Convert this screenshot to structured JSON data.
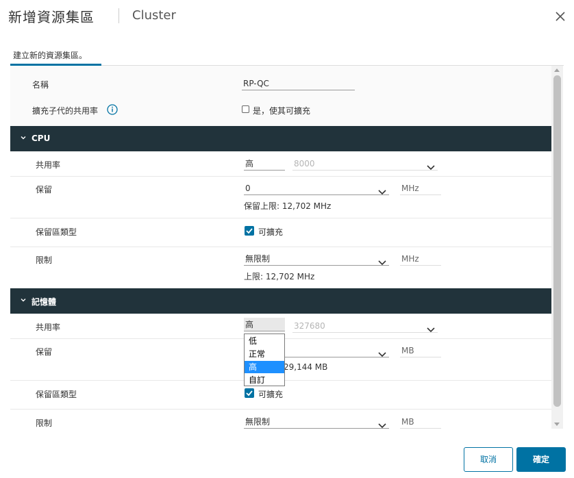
{
  "header": {
    "title": "新增資源集區",
    "subtitle": "Cluster"
  },
  "tab": {
    "label": "建立新的資源集區。"
  },
  "general": {
    "name_label": "名稱",
    "name_value": "RP-QC",
    "scalable_label": "擴充子代的共用率",
    "scalable_checkbox_label": "是，使其可擴充"
  },
  "cpu": {
    "header": "CPU",
    "shares_label": "共用率",
    "shares_level": "高",
    "shares_value": "8000",
    "reservation_label": "保留",
    "reservation_value": "0",
    "reservation_unit": "MHz",
    "reservation_max": "保留上限: 12,702 MHz",
    "reservation_type_label": "保留區類型",
    "reservation_type_value": "可擴充",
    "limit_label": "限制",
    "limit_value": "無限制",
    "limit_unit": "MHz",
    "limit_max": "上限: 12,702 MHz"
  },
  "memory": {
    "header": "記憶體",
    "shares_label": "共用率",
    "shares_level": "高",
    "shares_value": "327680",
    "reservation_label": "保留",
    "reservation_unit": "MB",
    "reservation_max_partial": "29,144 MB",
    "reservation_type_label": "保留區類型",
    "reservation_type_value": "可擴充",
    "limit_label": "限制",
    "limit_value": "無限制",
    "limit_unit": "MB"
  },
  "shares_dropdown": {
    "options": [
      "低",
      "正常",
      "高",
      "自訂"
    ],
    "selected_index": 2
  },
  "footer": {
    "cancel_label": "取消",
    "ok_label": "確定"
  },
  "colors": {
    "accent": "#0072a3",
    "section_header": "#21333b",
    "dropdown_highlight": "#1e90ff"
  }
}
